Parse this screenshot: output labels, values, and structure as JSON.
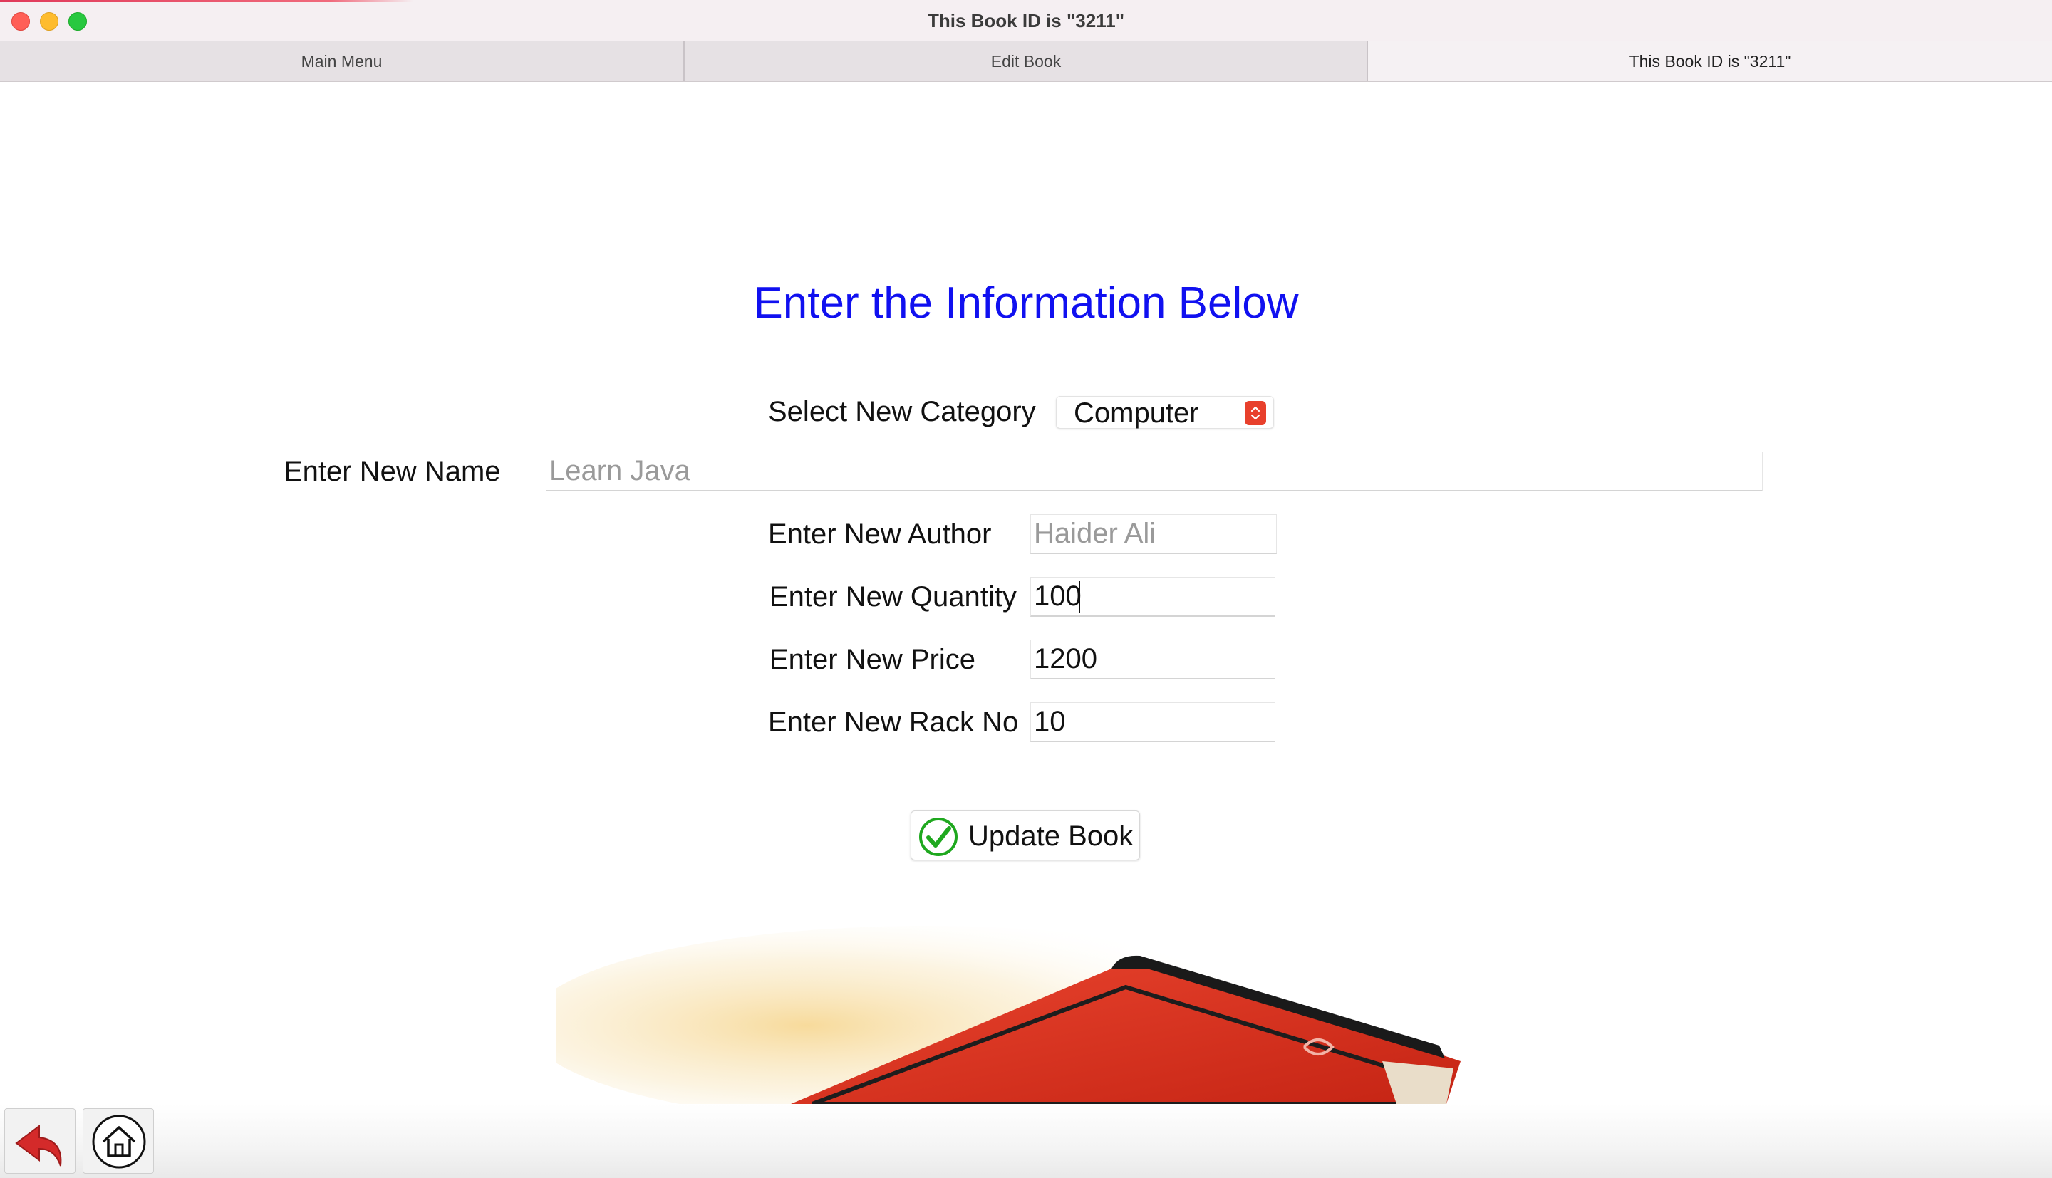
{
  "window": {
    "title": "This Book ID is \"3211\""
  },
  "tabs": [
    {
      "label": "Main Menu",
      "active": false
    },
    {
      "label": "Edit Book",
      "active": false
    },
    {
      "label": "This Book ID is \"3211\"",
      "active": true
    }
  ],
  "form": {
    "heading": "Enter the Information Below",
    "category": {
      "label": "Select New Category",
      "value": "Computer"
    },
    "name": {
      "label": "Enter New Name",
      "value": "",
      "placeholder": "Learn Java"
    },
    "author": {
      "label": "Enter New Author",
      "value": "",
      "placeholder": "Haider Ali"
    },
    "quantity": {
      "label": "Enter New Quantity",
      "value": "100"
    },
    "price": {
      "label": "Enter New Price",
      "value": "1200"
    },
    "rack": {
      "label": "Enter New Rack No",
      "value": "10"
    },
    "submit_label": "Update Book"
  },
  "colors": {
    "heading": "#1010f0",
    "select_arrow": "#e8402c",
    "check": "#1fa81f",
    "back_arrow": "#d42a2a"
  },
  "icons": {
    "back": "back-arrow-icon",
    "home": "home-icon",
    "submit": "check-circle-icon"
  }
}
